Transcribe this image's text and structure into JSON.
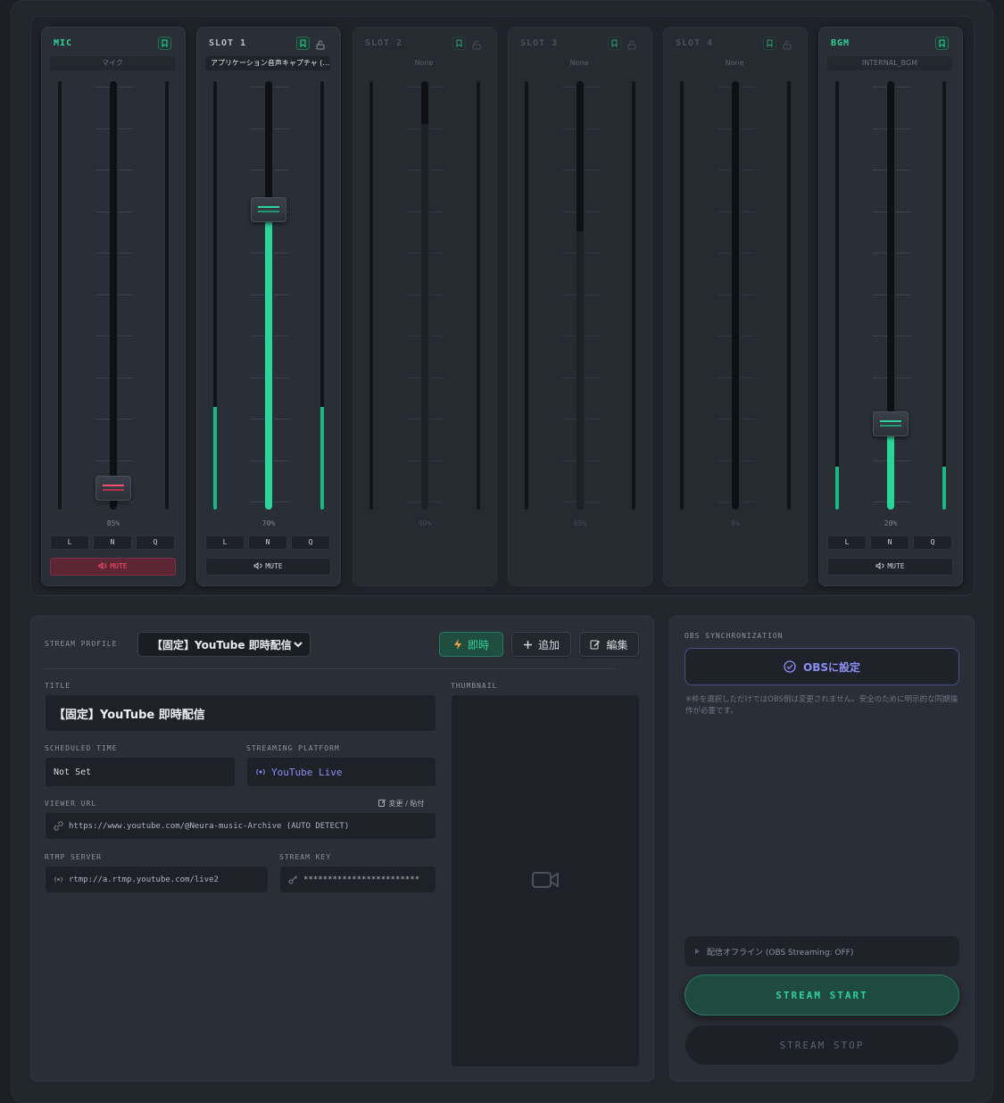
{
  "mixer": {
    "channels": [
      {
        "name": "MIC",
        "source": "マイク",
        "volume_pct": "85%",
        "level": 0.05,
        "meter": 0,
        "muted": true,
        "eq": [
          "L",
          "N",
          "Q"
        ],
        "mute_label": "MUTE"
      },
      {
        "name": "SLOT 1",
        "source": "アプリケーション音声キャプチャ (…",
        "volume_pct": "70%",
        "level": 0.7,
        "meter": 0.24,
        "muted": false,
        "eq": [
          "L",
          "N",
          "Q"
        ],
        "mute_label": "MUTE"
      },
      {
        "name": "SLOT 2",
        "source": "None",
        "volume_pct": "90%",
        "level": 0.9,
        "meter": 0,
        "disabled": true
      },
      {
        "name": "SLOT 3",
        "source": "None",
        "volume_pct": "65%",
        "level": 0.65,
        "meter": 0,
        "disabled": true
      },
      {
        "name": "SLOT 4",
        "source": "None",
        "volume_pct": "0%",
        "level": 0,
        "meter": 0,
        "disabled": true
      },
      {
        "name": "BGM",
        "source": "INTERNAL_BGM",
        "volume_pct": "20%",
        "level": 0.2,
        "meter": 0.1,
        "muted": false,
        "eq": [
          "L",
          "N",
          "Q"
        ],
        "mute_label": "MUTE"
      }
    ]
  },
  "profile": {
    "section_label": "STREAM PROFILE",
    "selected": "【固定】YouTube 即時配信",
    "btn_instant": "即時",
    "btn_add": "追加",
    "btn_edit": "編集",
    "title_label": "TITLE",
    "title_value": "【固定】YouTube 即時配信",
    "thumbnail_label": "THUMBNAIL",
    "scheduled_label": "SCHEDULED TIME",
    "scheduled_value": "Not Set",
    "platform_label": "STREAMING PLATFORM",
    "platform_value": "YouTube Live",
    "viewer_url_label": "VIEWER URL",
    "viewer_url_actions": "変更 / 貼付",
    "viewer_url_value": "https://www.youtube.com/@Neura-music-Archive (AUTO DETECT)",
    "rtmp_label": "RTMP SERVER",
    "rtmp_value": "rtmp://a.rtmp.youtube.com/live2",
    "key_label": "STREAM KEY",
    "key_value": "************************"
  },
  "obs": {
    "section_label": "OBS SYNCHRONIZATION",
    "set_button": "OBSに設定",
    "note": "※枠を選択しただけではOBS側は変更されません。安全のために明示的な同期操作が必要です。",
    "status": "配信オフライン (OBS Streaming: OFF)",
    "start_label": "STREAM START",
    "stop_label": "STREAM STOP"
  },
  "colors": {
    "accent_green": "#2fd39a",
    "mute_red": "#ff4d6d",
    "obs_purple": "#8a8ff5"
  }
}
